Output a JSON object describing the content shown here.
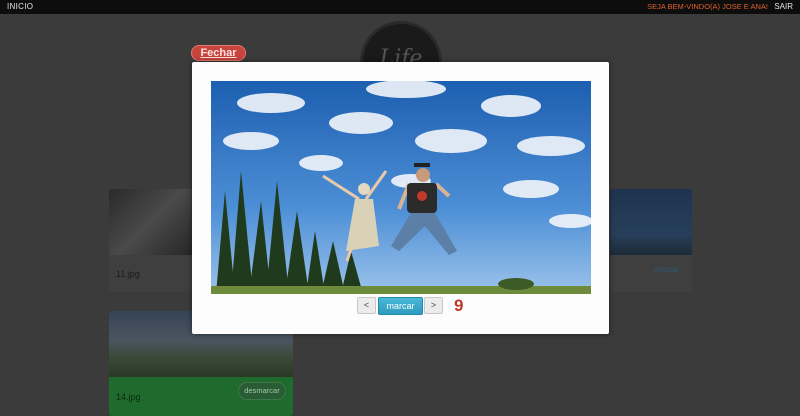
{
  "topbar": {
    "home_label": "INICIO",
    "welcome_text": "SEJA BEM-VINDO(A) JOSE E ANA!",
    "logout_label": "SAIR"
  },
  "background": {
    "close_label": "Fechar",
    "logo_text": "Life",
    "cards": [
      {
        "filename": "11.jpg"
      },
      {
        "mark_label": "marcar"
      },
      {
        "filename": "14.jpg",
        "unmark_label": "desmarcar"
      }
    ]
  },
  "lightbox": {
    "prev_label": "<",
    "mark_label": "marcar",
    "next_label": ">",
    "counter": "9"
  },
  "colors": {
    "accent_orange": "#e0602a",
    "mark_button": "#2d9ac0",
    "counter_red": "#c0392b",
    "selected_green": "#1f6a2d"
  }
}
